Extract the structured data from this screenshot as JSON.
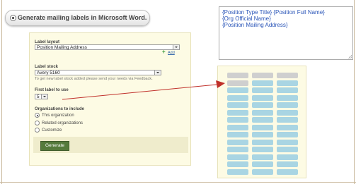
{
  "header": {
    "title": "Generate mailing labels in Microsoft Word."
  },
  "form": {
    "label_layout_label": "Label layout",
    "label_layout_value": "Position Mailing Address",
    "add_label": "Add",
    "label_stock_label": "Label stock",
    "label_stock_value": "Avery 5160",
    "label_stock_hint": "To get new label stock added please send your needs via Feedback.",
    "first_label_label": "First label to use",
    "first_label_value": "5",
    "orgs_label": "Organizations to include",
    "orgs_options": [
      "This organization",
      "Related organizations",
      "Customize"
    ],
    "orgs_selected": "This organization",
    "generate_label": "Generate"
  },
  "template_preview": {
    "lines": [
      "{Position Type Title} {Position Full Name}",
      "{Org Official Name}",
      "{Position Mailing Address}"
    ]
  },
  "label_sheet": {
    "columns": 3,
    "rows": 14,
    "used_labels": 4
  },
  "colors": {
    "accent_green": "#557a3b",
    "arrow_red": "#c0302a",
    "used_label": "#cfcfcf",
    "free_label": "#a9d5e3"
  }
}
